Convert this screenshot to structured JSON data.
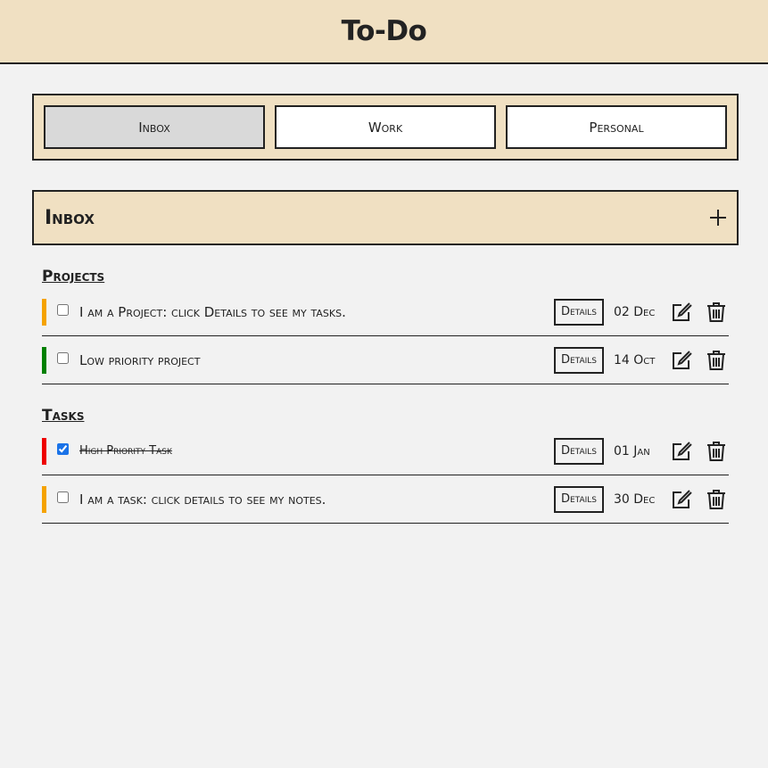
{
  "app": {
    "title": "To-Do"
  },
  "tabs": [
    {
      "label": "Inbox",
      "active": true
    },
    {
      "label": "Work",
      "active": false
    },
    {
      "label": "Personal",
      "active": false
    }
  ],
  "current_project": {
    "title": "Inbox"
  },
  "sections": {
    "projects": {
      "title": "Projects",
      "items": [
        {
          "label": "I am a Project: click Details to see my tasks.",
          "date": "02 Dec",
          "details_label": "Details",
          "priority_color": "#f5a300",
          "checked": false
        },
        {
          "label": "Low priority project",
          "date": "14 Oct",
          "details_label": "Details",
          "priority_color": "#008000",
          "checked": false
        }
      ]
    },
    "tasks": {
      "title": "Tasks",
      "items": [
        {
          "label": "High Priority Task",
          "date": "01 Jan",
          "details_label": "Details",
          "priority_color": "#ee0000",
          "checked": true
        },
        {
          "label": "I am a task: click details to see my notes.",
          "date": "30 Dec",
          "details_label": "Details",
          "priority_color": "#f5a300",
          "checked": false
        }
      ]
    }
  },
  "icons": {
    "add": "plus-icon",
    "edit": "edit-icon",
    "delete": "trash-icon"
  },
  "colors": {
    "header_bg": "#f0e0c2",
    "page_bg": "#f2f2f2",
    "active_tab_bg": "#d9d9d9"
  }
}
